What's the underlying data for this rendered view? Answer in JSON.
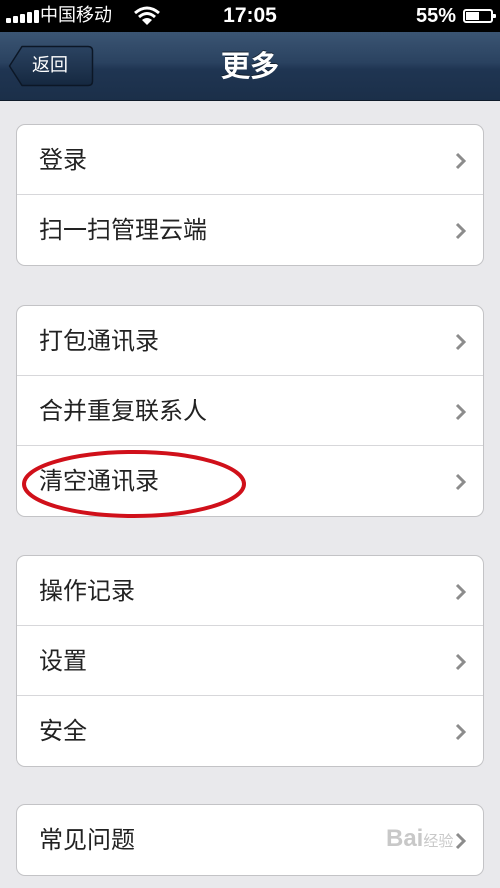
{
  "status_bar": {
    "carrier": "中国移动",
    "time": "17:05",
    "battery_percent": "55%",
    "battery_level": 0.55,
    "icons": [
      "signal-bars-icon",
      "wifi-icon",
      "battery-icon"
    ]
  },
  "navbar": {
    "back_label": "返回",
    "title": "更多"
  },
  "groups": [
    {
      "rows": [
        {
          "label": "登录"
        },
        {
          "label": "扫一扫管理云端"
        }
      ]
    },
    {
      "rows": [
        {
          "label": "打包通讯录"
        },
        {
          "label": "合并重复联系人"
        },
        {
          "label": "清空通讯录"
        }
      ]
    },
    {
      "rows": [
        {
          "label": "操作记录"
        },
        {
          "label": "设置"
        },
        {
          "label": "安全"
        }
      ]
    },
    {
      "rows": [
        {
          "label": "常见问题"
        }
      ]
    }
  ],
  "annotation": {
    "highlighted_item": "清空通讯录",
    "color": "#d0101a"
  },
  "colors": {
    "navbar": "#2a4260",
    "background": "#e9e9ec",
    "chevron": "#8c8c8c"
  }
}
